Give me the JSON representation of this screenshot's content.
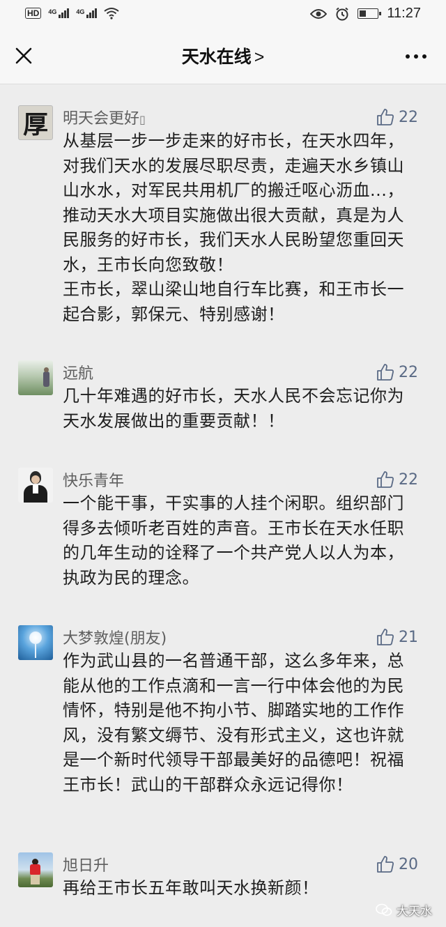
{
  "status_bar": {
    "hd": "HD",
    "net1": "4G",
    "net2": "4G",
    "battery_level": 0.3,
    "time": "11:27"
  },
  "nav": {
    "title": "天水在线",
    "chevron": ">"
  },
  "comments": [
    {
      "name": "明天会更好",
      "name_suffix": "▯",
      "likes": "22",
      "avatar_char": "厚",
      "paragraphs": [
        "从基层一步一步走来的好市长，在天水四年，对我们天水的发展尽职尽责，走遍天水乡镇山山水水，对军民共用机厂的搬迁呕心沥血...，推动天水大项目实施做出很大贡献，真是为人民服务的好市长，我们天水人民盼望您重回天水，王市长向您致敬！",
        "王市长，翠山梁山地自行车比赛，和王市长一起合影，郭保元、特别感谢！"
      ]
    },
    {
      "name": "远航",
      "likes": "22",
      "paragraphs": [
        "几十年难遇的好市长，天水人民不会忘记你为天水发展做出的重要贡献！！"
      ]
    },
    {
      "name": "快乐青年",
      "likes": "22",
      "paragraphs": [
        "一个能干事，干实事的人挂个闲职。组织部门得多去倾听老百姓的声音。王市长在天水任职的几年生动的诠释了一个共产党人以人为本，执政为民的理念。"
      ]
    },
    {
      "name": "大梦敦煌(朋友)",
      "likes": "21",
      "paragraphs": [
        "作为武山县的一名普通干部，这么多年来，总能从他的工作点滴和一言一行中体会他的为民情怀，特别是他不拘小节、脚踏实地的工作作风，没有繁文缛节、没有形式主义，这也许就是一个新时代领导干部最美好的品德吧！祝福王市长！武山的干部群众永远记得你！"
      ]
    },
    {
      "name": "旭日升",
      "likes": "20",
      "paragraphs": [
        "再给王市长五年敢叫天水换新颜！"
      ]
    }
  ],
  "watermark": "大天水",
  "colors": {
    "page_bg": "#ededed",
    "bar_bg": "#f7f7f7",
    "like_color": "#5a6a85",
    "name_color": "#5e5e5e"
  }
}
